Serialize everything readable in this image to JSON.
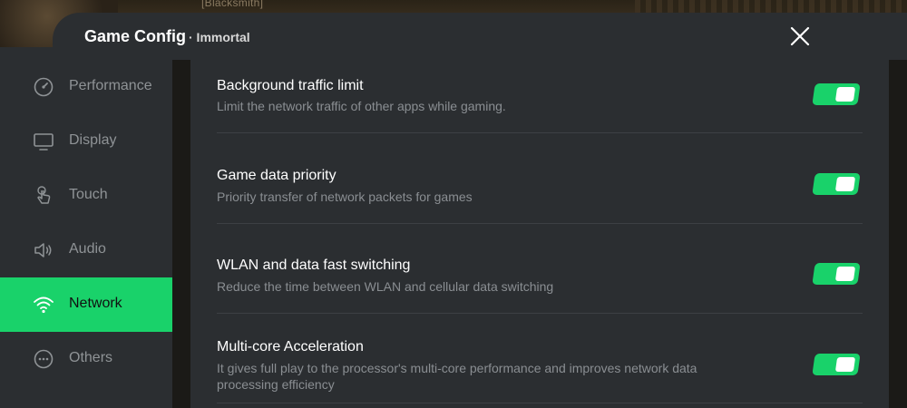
{
  "game_overlay": {
    "tag_text": "[Blacksmith]"
  },
  "header": {
    "title": "Game Config",
    "subtitle": "· Immortal"
  },
  "sidebar": {
    "items": [
      {
        "label": "Performance",
        "icon": "gauge-icon",
        "active": false
      },
      {
        "label": "Display",
        "icon": "monitor-icon",
        "active": false
      },
      {
        "label": "Touch",
        "icon": "touch-hand-icon",
        "active": false
      },
      {
        "label": "Audio",
        "icon": "speaker-icon",
        "active": false
      },
      {
        "label": "Network",
        "icon": "wifi-icon",
        "active": true
      },
      {
        "label": "Others",
        "icon": "more-dots-icon",
        "active": false
      }
    ]
  },
  "settings": [
    {
      "title": "Background traffic limit",
      "description": "Limit the network traffic of other apps while gaming.",
      "enabled": true
    },
    {
      "title": "Game data priority",
      "description": "Priority transfer of network packets for games",
      "enabled": true
    },
    {
      "title": "WLAN and data fast switching",
      "description": "Reduce the time between WLAN and cellular data switching",
      "enabled": true
    },
    {
      "title": "Multi-core Acceleration",
      "description": "It gives full play to the processor's multi-core performance and improves network data processing efficiency",
      "enabled": true
    }
  ],
  "colors": {
    "accent": "#19d26a",
    "panel": "#2b2e31",
    "text_muted": "#8f9396"
  }
}
